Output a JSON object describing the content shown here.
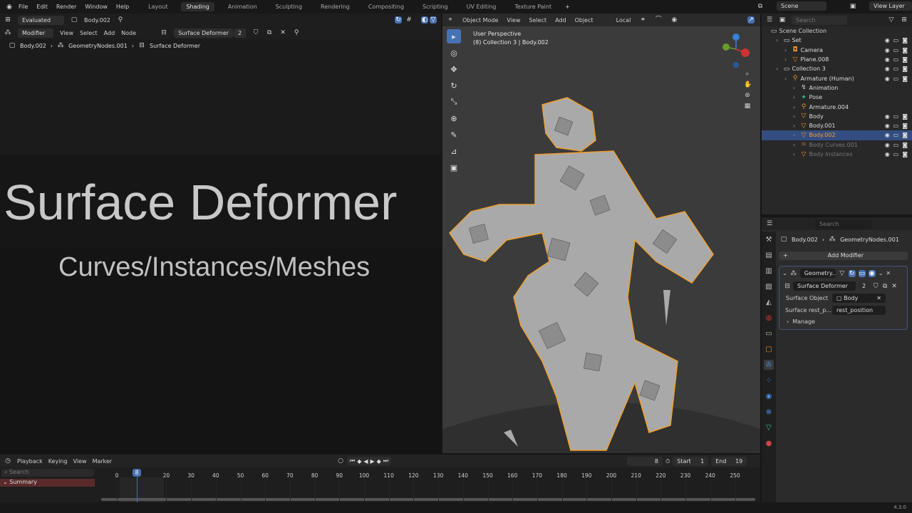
{
  "menu": {
    "items": [
      "File",
      "Edit",
      "Render",
      "Window",
      "Help"
    ]
  },
  "workspaces": [
    "Layout",
    "Shading",
    "Animation",
    "Sculpting",
    "Rendering",
    "Compositing",
    "Scripting",
    "UV Editing",
    "Texture Paint"
  ],
  "active_workspace": "Shading",
  "scene": {
    "name": "Scene",
    "view_layer": "View Layer"
  },
  "node_editor": {
    "context": "Evaluated",
    "object": "Body.002",
    "header": [
      "Modifier",
      "View",
      "Select",
      "Add",
      "Node"
    ],
    "node_group": "Surface Deformer",
    "users": "2",
    "breadcrumb": [
      "Body.002",
      "GeometryNodes.001",
      "Surface Deformer"
    ],
    "title": "Surface Deformer",
    "subtitle": "Curves/Instances/Meshes"
  },
  "viewport": {
    "mode": "Object Mode",
    "menus": [
      "View",
      "Select",
      "Add",
      "Object"
    ],
    "orientation": "Local",
    "info_line1": "User Perspective",
    "info_line2": "(8) Collection 3 | Body.002"
  },
  "outliner": {
    "search_placeholder": "Search",
    "root": "Scene Collection",
    "items": [
      {
        "label": "Set",
        "indent": 1,
        "type": "collection"
      },
      {
        "label": "Camera",
        "indent": 2,
        "type": "camera"
      },
      {
        "label": "Plane.008",
        "indent": 2,
        "type": "mesh"
      },
      {
        "label": "Collection 3",
        "indent": 1,
        "type": "collection"
      },
      {
        "label": "Armature (Human)",
        "indent": 2,
        "type": "armature"
      },
      {
        "label": "Animation",
        "indent": 3,
        "type": "action"
      },
      {
        "label": "Pose",
        "indent": 3,
        "type": "pose"
      },
      {
        "label": "Armature.004",
        "indent": 3,
        "type": "armature"
      },
      {
        "label": "Body",
        "indent": 3,
        "type": "mesh"
      },
      {
        "label": "Body.001",
        "indent": 3,
        "type": "mesh"
      },
      {
        "label": "Body.002",
        "indent": 3,
        "type": "mesh",
        "selected": true
      },
      {
        "label": "Body Curves.001",
        "indent": 3,
        "type": "curves",
        "dim": true
      },
      {
        "label": "Body Instances",
        "indent": 3,
        "type": "mesh",
        "dim": true
      }
    ]
  },
  "properties": {
    "search_placeholder": "Search",
    "breadcrumb": [
      "Body.002",
      "GeometryNodes.001"
    ],
    "add_modifier": "Add Modifier",
    "modifier_name": "Geometry...",
    "node_group": "Surface Deformer",
    "users": "2",
    "fields": [
      {
        "label": "Surface Object",
        "value": "Body"
      },
      {
        "label": "Surface rest_p...",
        "value": "rest_position"
      }
    ],
    "manage": "Manage"
  },
  "timeline": {
    "menus": [
      "Playback",
      "Keying",
      "View",
      "Marker"
    ],
    "current_frame": "8",
    "start_label": "Start",
    "start": "1",
    "end_label": "End",
    "end": "19",
    "search_placeholder": "Search",
    "summary": "Summary",
    "ticks": [
      "0",
      "20",
      "30",
      "40",
      "50",
      "60",
      "70",
      "80",
      "90",
      "100",
      "110",
      "120",
      "130",
      "140",
      "150",
      "160",
      "170",
      "180",
      "190",
      "200",
      "210",
      "220",
      "230",
      "240",
      "250"
    ]
  },
  "status": {
    "version": "4.3.0"
  },
  "colors": {
    "accent": "#4772b3",
    "selected_outline": "#f0a030",
    "summary": "#5a2a2a"
  }
}
